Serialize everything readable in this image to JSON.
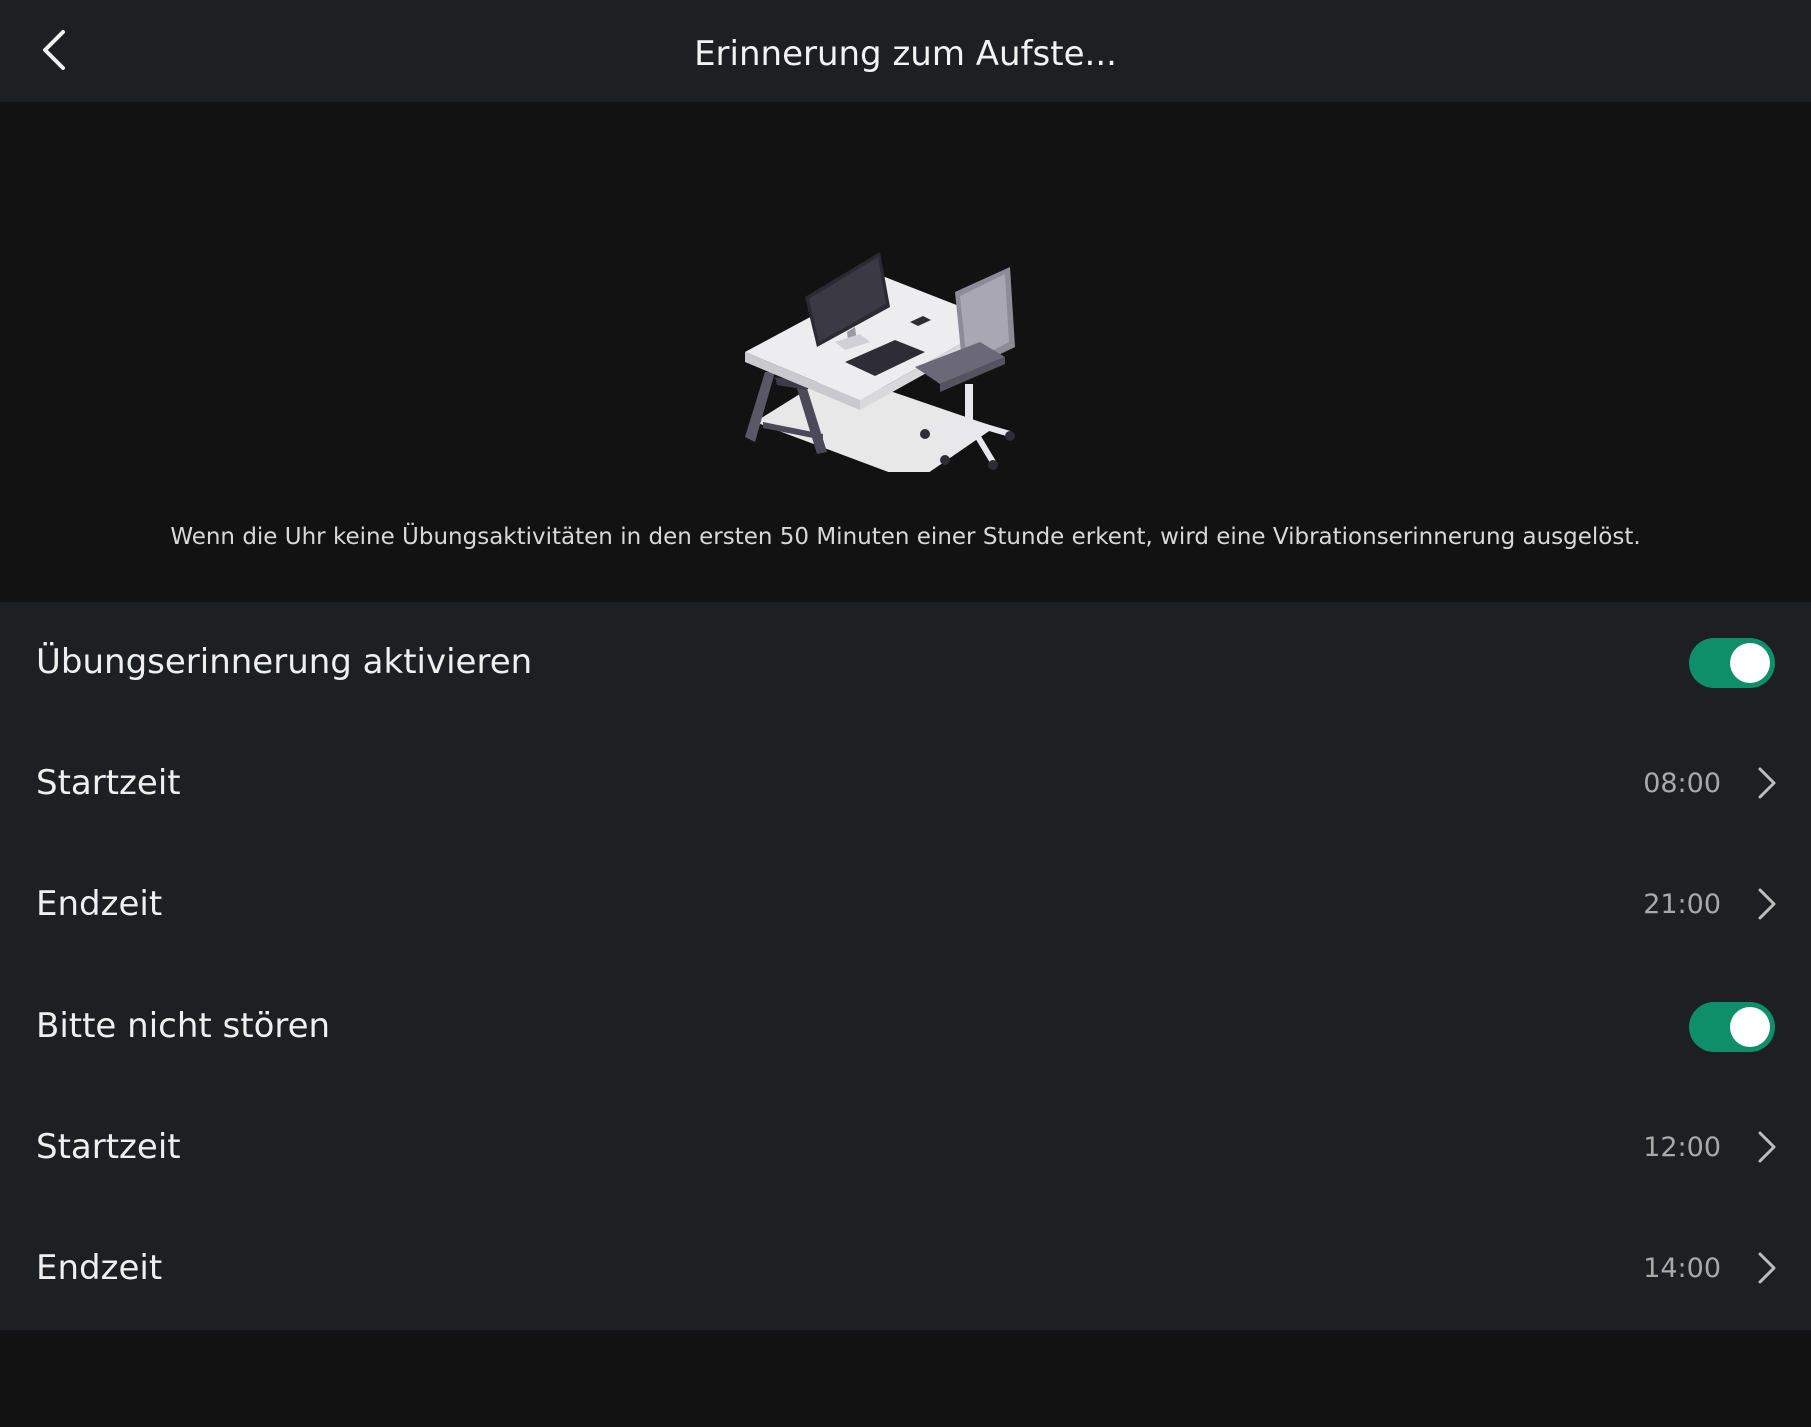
{
  "header": {
    "title": "Erinnerung zum Aufste..."
  },
  "hero": {
    "illustration": "desk-and-chair-illustration",
    "description": "Wenn die Uhr keine Übungsaktivitäten in den ersten 50 Minuten einer Stunde erkent, wird eine Vibrationserinnerung ausgelöst."
  },
  "settings": {
    "exercise_reminder": {
      "label": "Übungserinnerung aktivieren",
      "enabled": true
    },
    "exercise_start": {
      "label": "Startzeit",
      "value": "08:00"
    },
    "exercise_end": {
      "label": "Endzeit",
      "value": "21:00"
    },
    "dnd": {
      "label": "Bitte nicht stören",
      "enabled": true
    },
    "dnd_start": {
      "label": "Startzeit",
      "value": "12:00"
    },
    "dnd_end": {
      "label": "Endzeit",
      "value": "14:00"
    }
  },
  "colors": {
    "toggle_on": "#0e8f6a",
    "header_bg": "#1e1f22",
    "page_bg": "#121212"
  }
}
